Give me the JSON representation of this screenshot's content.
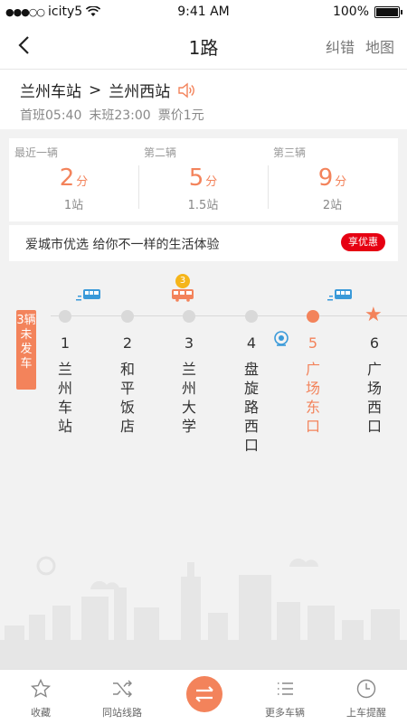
{
  "status_bar": {
    "carrier": "icity5",
    "time": "9:41 AM",
    "battery": "100%"
  },
  "nav": {
    "title": "1路",
    "report_label": "纠错",
    "map_label": "地图"
  },
  "route": {
    "from": "兰州车站",
    "separator": ">",
    "to": "兰州西站",
    "first_bus": "首班05:40",
    "last_bus": "末班23:00",
    "fare": "票价1元"
  },
  "arrivals": [
    {
      "label": "最近一辆",
      "minutes": "2",
      "unit": "分",
      "stops": "1站"
    },
    {
      "label": "第二辆",
      "minutes": "5",
      "unit": "分",
      "stops": "1.5站"
    },
    {
      "label": "第三辆",
      "minutes": "9",
      "unit": "分",
      "stops": "2站"
    }
  ],
  "promo": {
    "text": "爱城市优选 给你不一样的生活体验",
    "button": "享优惠"
  },
  "line": {
    "not_departed": "3辆未发车",
    "bus_count_pin": "3",
    "stations": [
      {
        "num": "1",
        "name": "兰州车站"
      },
      {
        "num": "2",
        "name": "和平饭店"
      },
      {
        "num": "3",
        "name": "兰州大学"
      },
      {
        "num": "4",
        "name": "盘旋路西口"
      },
      {
        "num": "5",
        "name": "广场东口"
      },
      {
        "num": "6",
        "name": "广场西口"
      }
    ]
  },
  "tabbar": {
    "favorite": "收藏",
    "same_station": "同站线路",
    "more_buses": "更多车辆",
    "reminder": "上车提醒"
  },
  "colors": {
    "accent": "#f3835b",
    "bus_blue": "#3a9ad9",
    "promo_red": "#e60012"
  },
  "icons": [
    "back-icon",
    "speaker-icon",
    "bus-icon",
    "camera-icon",
    "star-icon",
    "swap-icon",
    "shuffle-icon",
    "list-icon",
    "clock-icon"
  ]
}
